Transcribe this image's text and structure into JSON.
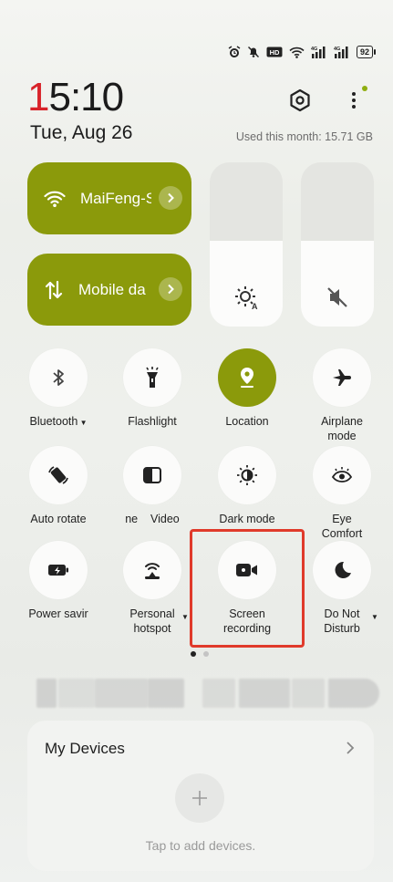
{
  "status_bar": {
    "battery": "92"
  },
  "header": {
    "time_first": "1",
    "time_rest": "5:10",
    "date": "Tue, Aug 26",
    "usage": "Used this month: 15.71 GB"
  },
  "tiles": {
    "wifi_label": "MaiFeng-S",
    "mobile_label": "Mobile da"
  },
  "sliders": {
    "brightness_level": 0.52,
    "volume_level": 0.52
  },
  "toggles": [
    {
      "label": "Bluetooth",
      "active": false
    },
    {
      "label": "Flashlight",
      "active": false
    },
    {
      "label": "Location",
      "active": true
    },
    {
      "label": "Airplane mode",
      "active": false
    },
    {
      "label": "Auto rotate",
      "active": false
    },
    {
      "label": "ne    Video",
      "active": false
    },
    {
      "label": "Dark mode",
      "active": false
    },
    {
      "label": "Eye Comfort",
      "active": false
    },
    {
      "label": "Power savir",
      "active": false
    },
    {
      "label": "Personal hotspot",
      "active": false
    },
    {
      "label": "Screen recording",
      "active": false
    },
    {
      "label": "Do Not Disturb",
      "active": false
    }
  ],
  "devices": {
    "title": "My Devices",
    "hint": "Tap to add devices."
  },
  "colors": {
    "accent": "#8b9a0b",
    "highlight": "#e03a2b",
    "clock_red": "#d8232a"
  }
}
